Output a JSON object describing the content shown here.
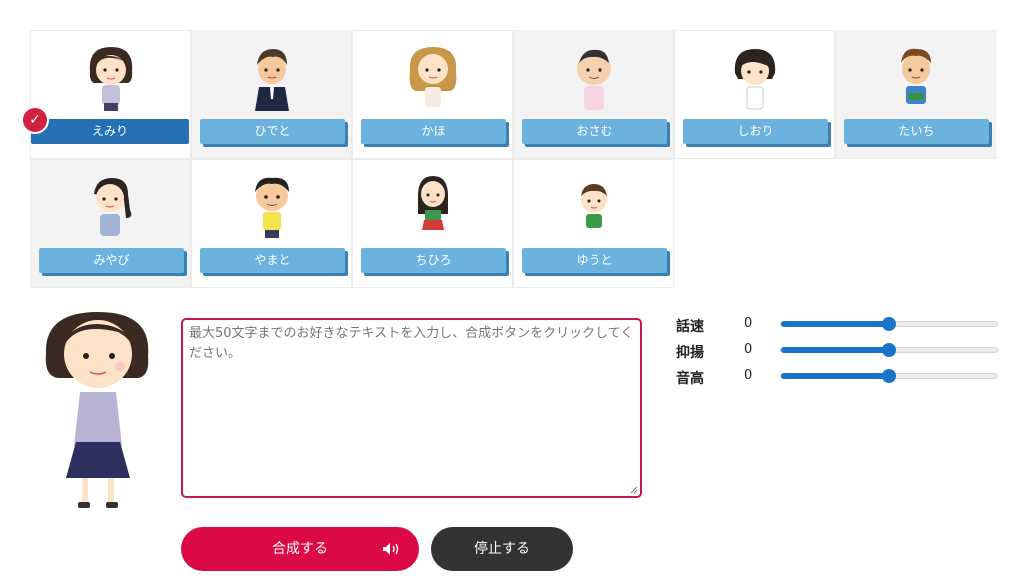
{
  "characters": [
    {
      "name": "えみり",
      "selected": true
    },
    {
      "name": "ひでと",
      "selected": false
    },
    {
      "name": "かほ",
      "selected": false
    },
    {
      "name": "おさむ",
      "selected": false
    },
    {
      "name": "しおり",
      "selected": false
    },
    {
      "name": "たいち",
      "selected": false
    },
    {
      "name": "みやび",
      "selected": false
    },
    {
      "name": "やまと",
      "selected": false
    },
    {
      "name": "ちひろ",
      "selected": false
    },
    {
      "name": "ゆうと",
      "selected": false
    }
  ],
  "text_input": {
    "placeholder": "最大50文字までのお好きなテキストを入力し、合成ボタンをクリックしてください。",
    "value": ""
  },
  "params": [
    {
      "label": "話速",
      "value": "0",
      "level": 0.5
    },
    {
      "label": "抑揚",
      "value": "0",
      "level": 0.5
    },
    {
      "label": "音高",
      "value": "0",
      "level": 0.5
    }
  ],
  "buttons": {
    "synth_label": "合成する",
    "stop_label": "停止する"
  },
  "colors": {
    "selected_name": "#2670b5",
    "name_button": "#6cb2df",
    "synth_button": "#dc0a44",
    "stop_button": "#333333",
    "slider": "#1a73c8",
    "textarea_border": "#c81650",
    "check_badge": "#d2203f"
  },
  "icons": {
    "check": "check-circle-icon",
    "speaker": "speaker-icon"
  }
}
